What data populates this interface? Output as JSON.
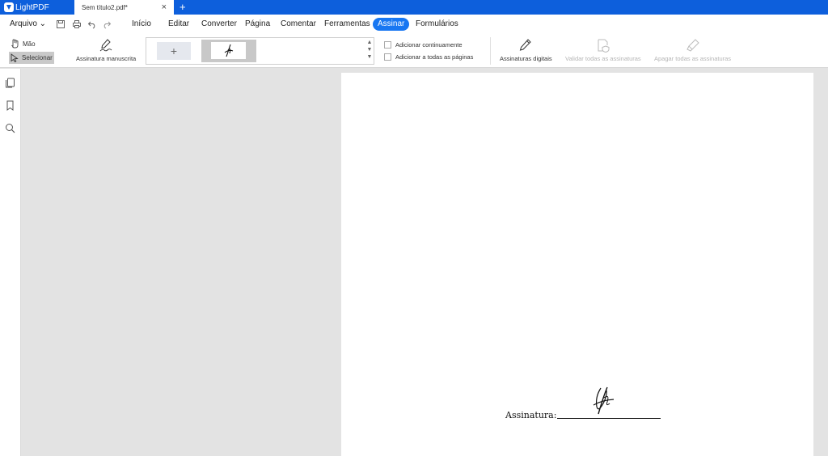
{
  "app": {
    "name": "LightPDF",
    "document_tab": "Sem título2.pdf*",
    "close_symbol": "×",
    "new_tab_symbol": "+"
  },
  "menu": {
    "file": "Arquivo ⌄",
    "items": [
      "Início",
      "Editar",
      "Converter",
      "Página",
      "Comentar",
      "Ferramentas",
      "Assinar",
      "Formulários"
    ],
    "active": "Assinar"
  },
  "toolbar": {
    "hand": "Mão",
    "select": "Selecionar",
    "handwritten_signature": "Assinatura manuscrita",
    "add_symbol": "+",
    "add_continuously": "Adicionar continuamente",
    "add_all_pages": "Adicionar a todas as páginas",
    "digital_signatures": "Assinaturas digitais",
    "validate_all": "Validar todas as assinaturas",
    "delete_all": "Apagar todas as assinaturas"
  },
  "document": {
    "signature_label": "Assinatura:"
  },
  "colors": {
    "titlebar": "#0d5fdc",
    "active_menu": "#1877f2",
    "canvas": "#e3e3e3"
  }
}
